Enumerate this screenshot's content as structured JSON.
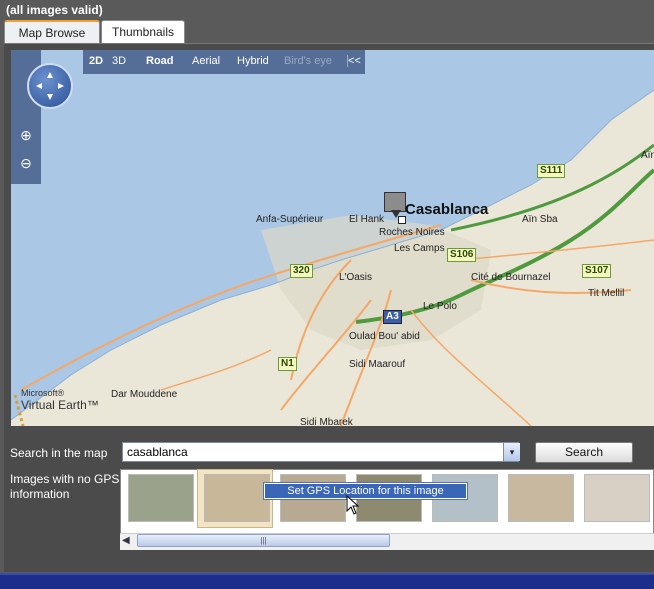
{
  "header": {
    "status": "(all images valid)"
  },
  "tabs": [
    {
      "label": "Map Browse"
    },
    {
      "label": "Thumbnails"
    }
  ],
  "map": {
    "modes": [
      "2D",
      "3D",
      "Road",
      "Aerial",
      "Hybrid",
      "Bird's eye"
    ],
    "collapse_glyph": "<<",
    "zoom_in": "⊕",
    "zoom_out": "⊖",
    "city_label": "Casablanca",
    "place_labels": [
      "Anfa-Supérieur",
      "El Hank",
      "Roches Noires",
      "Aïn Sba",
      "Les Camps",
      "L'Oasis",
      "Cité de Bournazel",
      "Tit Mellil",
      "Le Polo",
      "Oulad Bou' abid",
      "Sidi Maarouf",
      "Dar Mouddene",
      "Sidi Mbarek",
      "Aïn"
    ],
    "road_shields": [
      "S111",
      "S106",
      "S107",
      "320",
      "A3",
      "N1"
    ],
    "brand_line1": "Microsoft®",
    "brand_line2": "Virtual Earth™",
    "colors": {
      "water": "#aac7e5",
      "land": "#eae6d8",
      "urban": "#dcd8c8",
      "road": "#f4a868",
      "highway": "#4f9a3e"
    }
  },
  "search": {
    "label": "Search in the map",
    "value": "casablanca",
    "dropdown_glyph": "▾",
    "button_label": "Search"
  },
  "gallery": {
    "label": "Images with no GPS information",
    "context_menu_item": "Set GPS Location for this image",
    "scroll_grip": "|||",
    "thumb_colors": [
      "#9aa28c",
      "#c9b79a",
      "#b8aa92",
      "#8e8a70",
      "#b4c0c8",
      "#c8b8a0",
      "#d8d0c4"
    ]
  }
}
